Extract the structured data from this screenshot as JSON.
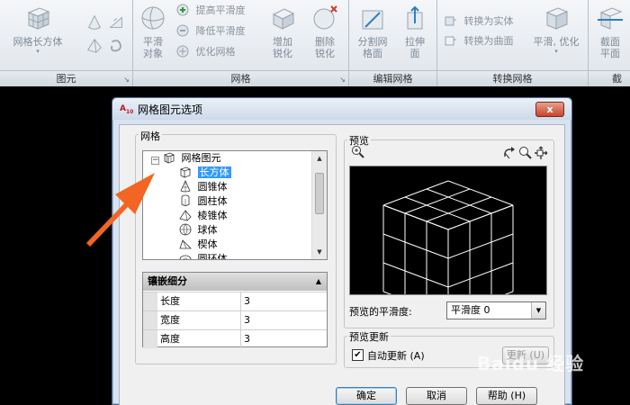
{
  "ribbon": {
    "primitives_panel": {
      "title": "图元",
      "box_button": "网格长方体"
    },
    "mesh_panel": {
      "title": "网格",
      "smooth_object": "平滑对象",
      "increase_smoothness": "提高平滑度",
      "decrease_smoothness": "降低平滑度",
      "refine_mesh": "优化网格"
    },
    "crease_panel": {
      "add_crease": "增加锐化",
      "remove_crease": "删除锐化"
    },
    "edit_mesh_panel": {
      "title": "编辑网格",
      "split_face": "分割网格面",
      "extrude_face": "拉伸面"
    },
    "convert_mesh_panel": {
      "title": "转换网格",
      "convert_to_solid": "转换为实体",
      "convert_to_surface": "转换为曲面",
      "smooth_optimized": "平滑, 优化"
    },
    "section_panel": {
      "section_plane": "截面平面",
      "title_partial": "截"
    }
  },
  "dialog": {
    "title": "网格图元选项",
    "close_glyph": "x",
    "mesh_group_label": "网格",
    "tree": {
      "root": "网格图元",
      "items": [
        "长方体",
        "圆锥体",
        "圆柱体",
        "棱锥体",
        "球体",
        "楔体",
        "圆环体"
      ],
      "selected_index": 0
    },
    "properties": {
      "header": "镶嵌细分",
      "rows": [
        {
          "name": "长度",
          "value": "3"
        },
        {
          "name": "宽度",
          "value": "3"
        },
        {
          "name": "高度",
          "value": "3"
        }
      ]
    },
    "preview": {
      "group_label": "预览",
      "smoothness_label": "预览的平滑度:",
      "smoothness_value": "平滑度 0"
    },
    "preview_update": {
      "group_label": "预览更新",
      "auto_update_label": "自动更新 (A)",
      "auto_update_checked": true,
      "update_button": "更新 (U)"
    },
    "buttons": {
      "ok": "确定",
      "cancel": "取消",
      "help": "帮助 (H)"
    }
  },
  "watermark": "Baidu 经验",
  "colors": {
    "selection": "#3399ff",
    "arrow": "#f26522",
    "close_button": "#c6452c",
    "wireframe": "#ffffff"
  }
}
